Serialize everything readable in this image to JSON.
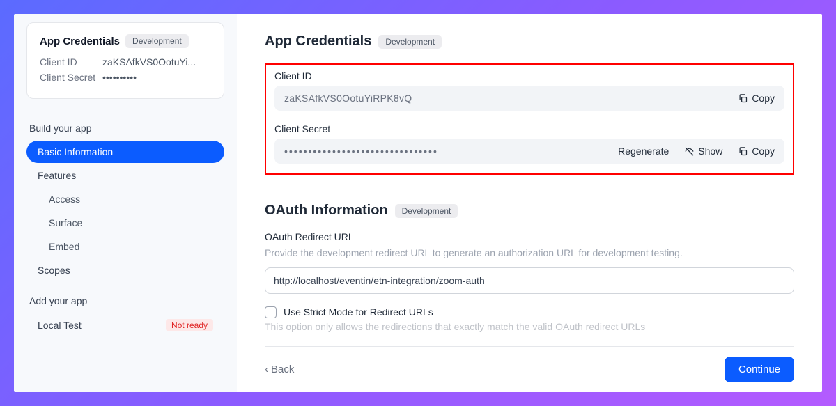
{
  "sidebar": {
    "card": {
      "title": "App Credentials",
      "badge": "Development",
      "client_id_label": "Client ID",
      "client_id_value": "zaKSAfkVS0OotuYi...",
      "client_secret_label": "Client Secret",
      "client_secret_value": "••••••••••"
    },
    "build_section": "Build your app",
    "items": [
      {
        "label": "Basic Information"
      },
      {
        "label": "Features"
      },
      {
        "label": "Access"
      },
      {
        "label": "Surface"
      },
      {
        "label": "Embed"
      },
      {
        "label": "Scopes"
      }
    ],
    "add_section": "Add your app",
    "add_items": [
      {
        "label": "Local Test",
        "status": "Not ready"
      }
    ]
  },
  "main": {
    "credentials": {
      "title": "App Credentials",
      "badge": "Development",
      "client_id_label": "Client ID",
      "client_id_value": "zaKSAfkVS0OotuYiRPK8vQ",
      "client_secret_label": "Client Secret",
      "client_secret_value": "••••••••••••••••••••••••••••••••",
      "copy": "Copy",
      "regenerate": "Regenerate",
      "show": "Show"
    },
    "oauth": {
      "title": "OAuth Information",
      "badge": "Development",
      "redirect_label": "OAuth Redirect URL",
      "redirect_help": "Provide the development redirect URL to generate an authorization URL for development testing.",
      "redirect_value": "http://localhost/eventin/etn-integration/zoom-auth",
      "strict_label": "Use Strict Mode for Redirect URLs",
      "strict_help": "This option only allows the redirections that exactly match the valid OAuth redirect URLs"
    },
    "footer": {
      "back": "Back",
      "continue": "Continue"
    }
  }
}
